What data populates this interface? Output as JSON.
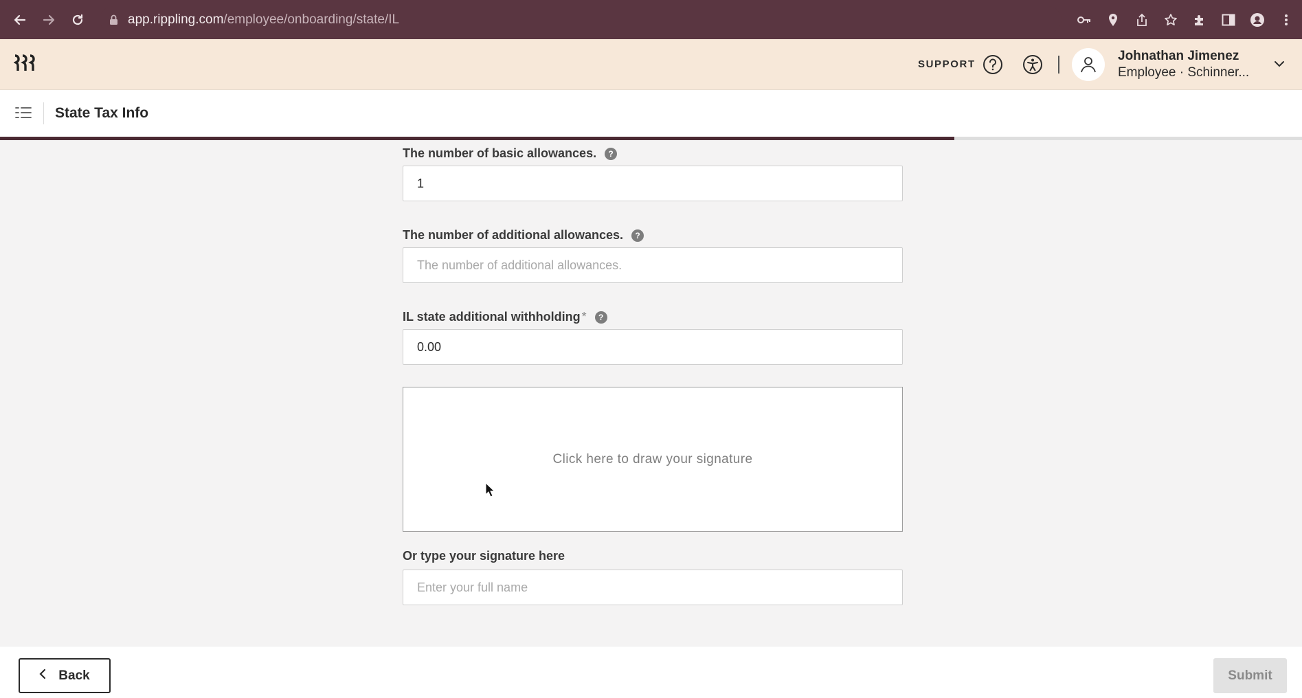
{
  "browser": {
    "url_host": "app.rippling.com",
    "url_path": "/employee/onboarding/state/IL"
  },
  "header": {
    "support_label": "SUPPORT",
    "user_name": "Johnathan Jimenez",
    "user_role": "Employee · Schinner..."
  },
  "page": {
    "title": "State Tax Info",
    "progress": 0.733
  },
  "form": {
    "basic_allowances": {
      "label": "The number of basic allowances.",
      "value": "1"
    },
    "additional_allowances": {
      "label": "The number of additional allowances.",
      "value": "",
      "placeholder": "The number of additional allowances."
    },
    "additional_withholding": {
      "label": "IL state additional withholding",
      "required_mark": "*",
      "value": "0.00"
    },
    "signature_pad": {
      "prompt": "Click here to draw your signature"
    },
    "typed_signature": {
      "label": "Or type your signature here",
      "value": "",
      "placeholder": "Enter your full name"
    }
  },
  "footer": {
    "back_label": "Back",
    "submit_label": "Submit"
  },
  "colors": {
    "browser_bar": "#5a3641",
    "app_header": "#f7e8d9",
    "progress": "#4b2a33"
  }
}
